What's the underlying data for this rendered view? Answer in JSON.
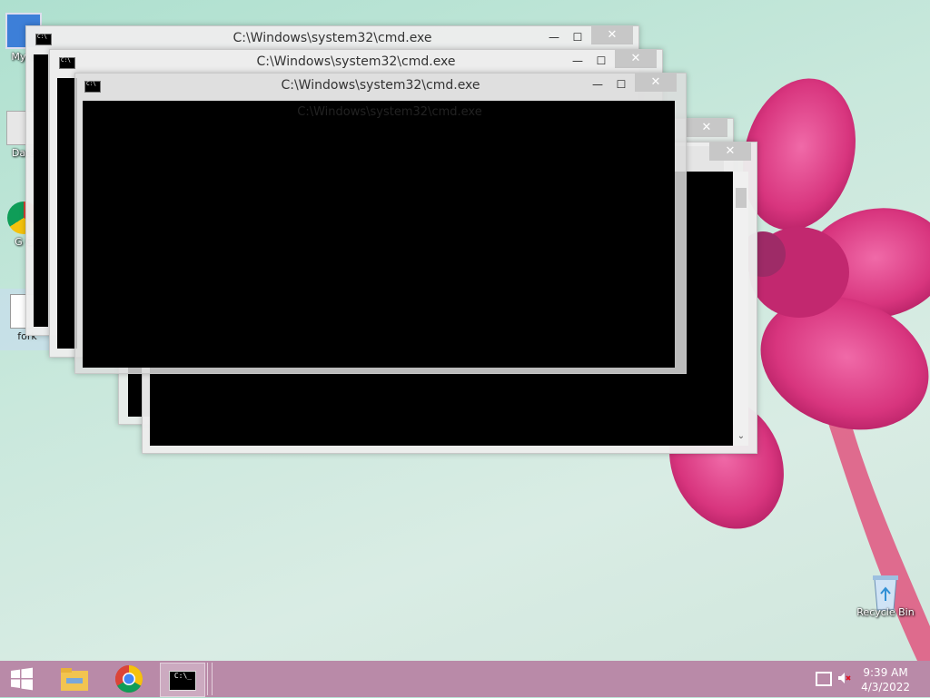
{
  "desktop": {
    "icons": [
      {
        "label": "My C",
        "name": "desktop-icon-my-computer"
      },
      {
        "label": "Data",
        "name": "desktop-icon-data"
      },
      {
        "label": "G C",
        "name": "desktop-icon-google-chrome"
      },
      {
        "label": "fork",
        "name": "desktop-icon-fork"
      },
      {
        "label": "Recycle Bin",
        "name": "desktop-icon-recycle-bin"
      }
    ]
  },
  "windows": [
    {
      "title": "C:\\Windows\\system32\\cmd.exe"
    },
    {
      "title": "C:\\Windows\\system32\\cmd.exe"
    },
    {
      "title": "C:\\Windows\\system32\\cmd.exe"
    },
    {
      "title": "C:\\Windows\\system32\\cmd.exe"
    }
  ],
  "buttons": {
    "minimize": "—",
    "maximize": "☐",
    "close": "✕"
  },
  "taskbar": {
    "items": [
      "start-button",
      "file-explorer",
      "google-chrome",
      "command-prompt"
    ],
    "time": "9:39 AM",
    "date": "4/3/2022"
  },
  "colors": {
    "taskbar": "#b98aa8",
    "close_button": "#c7c7c7",
    "console": "#000000"
  }
}
